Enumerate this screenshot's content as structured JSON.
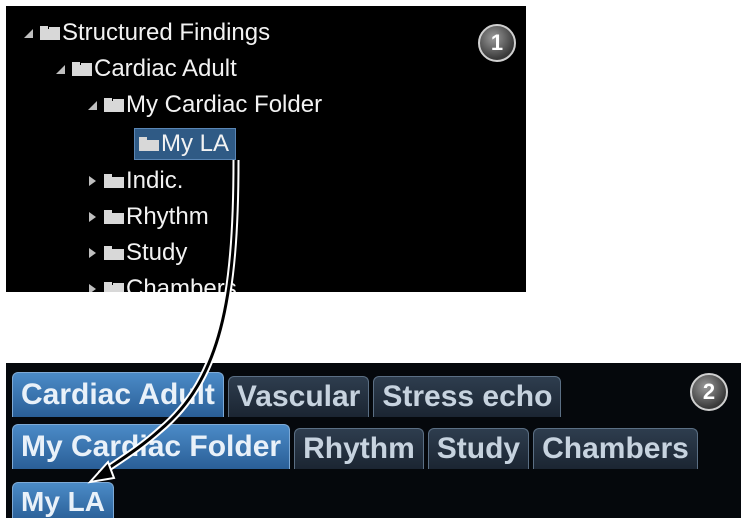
{
  "tree": {
    "items": [
      {
        "label": "Structured Findings",
        "expanded": true
      },
      {
        "label": "Cardiac Adult",
        "expanded": true
      },
      {
        "label": "My Cardiac Folder",
        "expanded": true
      },
      {
        "label": "My LA",
        "selected": true
      },
      {
        "label": "Indic.",
        "expanded": false
      },
      {
        "label": "Rhythm",
        "expanded": false
      },
      {
        "label": "Study",
        "expanded": false
      },
      {
        "label": "Chambers",
        "expanded": false
      }
    ],
    "badge": "1"
  },
  "tabs": {
    "row1": [
      "Cardiac Adult",
      "Vascular",
      "Stress echo"
    ],
    "row2": [
      "My Cardiac Folder",
      "Rhythm",
      "Study",
      "Chambers"
    ],
    "row3": [
      "My LA"
    ],
    "badge": "2"
  },
  "colors": {
    "panel_bg": "#000000",
    "selected_bg": "#2f5a85",
    "tab_active": "#3f7fbd",
    "tab_inactive": "#1f2a37",
    "text": "#f2f2f2"
  }
}
